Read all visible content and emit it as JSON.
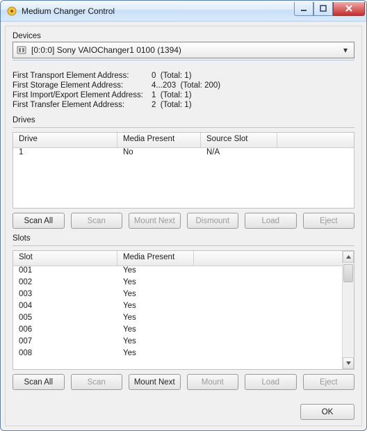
{
  "window": {
    "title": "Medium Changer Control"
  },
  "devices": {
    "label": "Devices",
    "selected": "[0:0:0] Sony VAIOChanger1 0100 (1394)"
  },
  "addresses": {
    "first_transport_label": "First Transport Element Address:",
    "first_transport_value": "0  (Total: 1)",
    "first_storage_label": "First Storage Element Address:",
    "first_storage_value": "4...203  (Total: 200)",
    "first_importexport_label": "First Import/Export Element Address:",
    "first_importexport_value": "1  (Total: 1)",
    "first_transfer_label": "First Transfer Element Address:",
    "first_transfer_value": "2  (Total: 1)"
  },
  "drives": {
    "label": "Drives",
    "columns": {
      "drive": "Drive",
      "media_present": "Media Present",
      "source_slot": "Source Slot"
    },
    "rows": [
      {
        "drive": "1",
        "media_present": "No",
        "source_slot": "N/A"
      }
    ],
    "buttons": {
      "scan_all": "Scan All",
      "scan": "Scan",
      "mount_next": "Mount Next",
      "dismount": "Dismount",
      "load": "Load",
      "eject": "Eject"
    }
  },
  "slots": {
    "label": "Slots",
    "columns": {
      "slot": "Slot",
      "media_present": "Media Present"
    },
    "rows": [
      {
        "slot": "001",
        "media_present": "Yes"
      },
      {
        "slot": "002",
        "media_present": "Yes"
      },
      {
        "slot": "003",
        "media_present": "Yes"
      },
      {
        "slot": "004",
        "media_present": "Yes"
      },
      {
        "slot": "005",
        "media_present": "Yes"
      },
      {
        "slot": "006",
        "media_present": "Yes"
      },
      {
        "slot": "007",
        "media_present": "Yes"
      },
      {
        "slot": "008",
        "media_present": "Yes"
      }
    ],
    "buttons": {
      "scan_all": "Scan All",
      "scan": "Scan",
      "mount_next": "Mount Next",
      "mount": "Mount",
      "load": "Load",
      "eject": "Eject"
    }
  },
  "footer": {
    "ok": "OK"
  }
}
